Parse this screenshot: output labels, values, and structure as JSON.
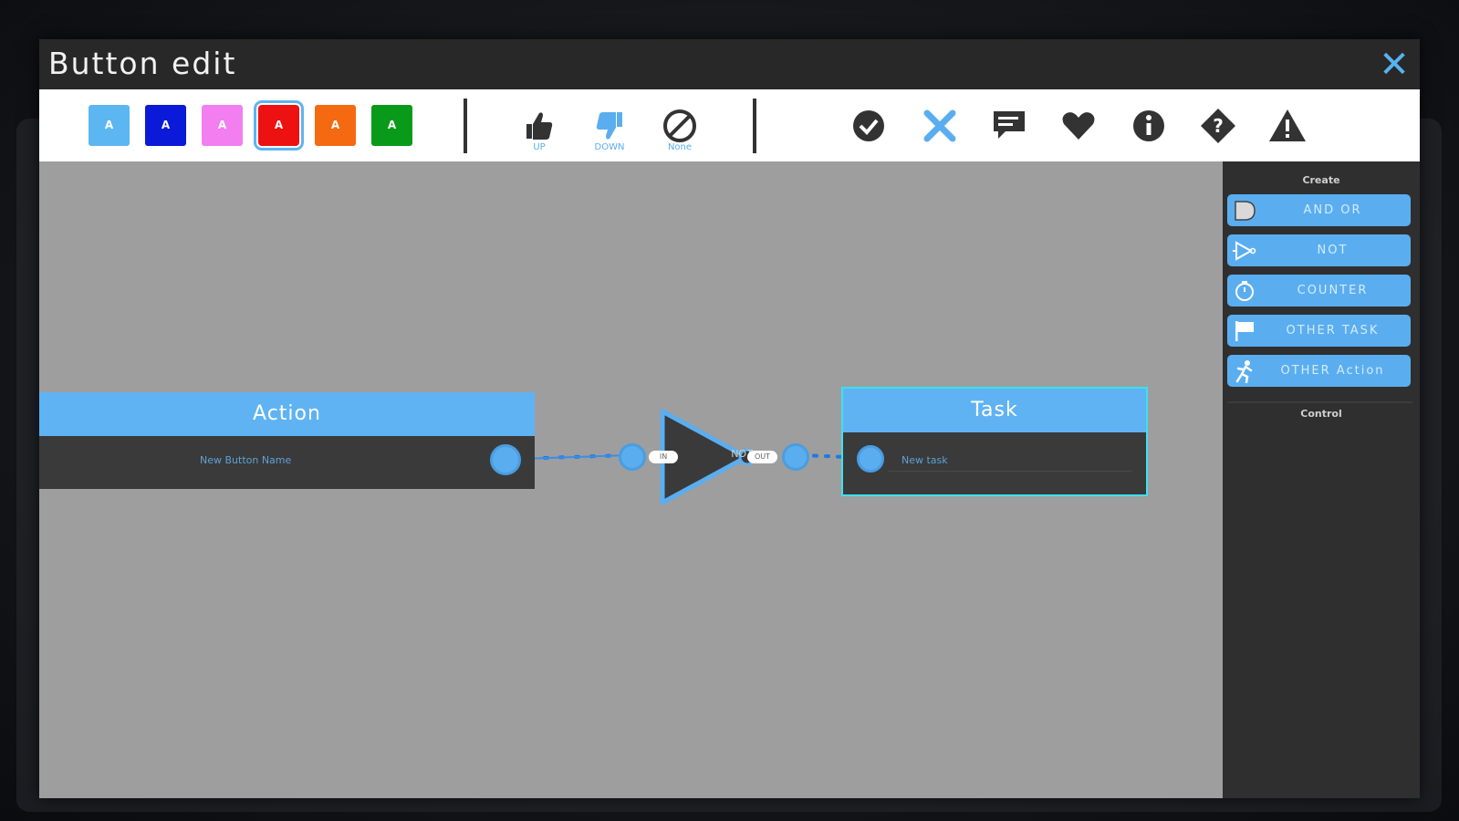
{
  "window": {
    "title": "Button edit",
    "close_label": "✕"
  },
  "toolbar": {
    "swatches": [
      {
        "label": "A",
        "color": "#5cb6f2"
      },
      {
        "label": "A",
        "color": "#0a1ad8"
      },
      {
        "label": "A",
        "color": "#f27ef0"
      },
      {
        "label": "A",
        "color": "#ee1111",
        "selected": true
      },
      {
        "label": "A",
        "color": "#f56a10"
      },
      {
        "label": "A",
        "color": "#0a9a1a"
      }
    ],
    "reactions": [
      {
        "icon": "thumbs-up-icon",
        "caption": "UP"
      },
      {
        "icon": "thumbs-down-icon",
        "caption": "DOWN"
      },
      {
        "icon": "none-icon",
        "caption": "None"
      }
    ],
    "icons": [
      "check-icon",
      "x-icon",
      "comment-icon",
      "heart-icon",
      "info-icon",
      "question-icon",
      "warning-icon"
    ]
  },
  "canvas": {
    "action_node": {
      "title": "Action",
      "field": "New Button Name"
    },
    "not_node": {
      "label": "NOT",
      "in_label": "IN",
      "out_label": "OUT"
    },
    "task_node": {
      "title": "Task",
      "field": "New task"
    }
  },
  "sidebar": {
    "create_heading": "Create",
    "buttons": [
      {
        "icon": "and-or-gate-icon",
        "label": "AND OR"
      },
      {
        "icon": "not-gate-icon",
        "label": "NOT"
      },
      {
        "icon": "timer-icon",
        "label": "COUNTER"
      },
      {
        "icon": "flag-icon",
        "label": "OTHER TASK"
      },
      {
        "icon": "running-figure-icon",
        "label": "OTHER Action"
      }
    ],
    "control_heading": "Control"
  },
  "colors": {
    "accent": "#5aaef0",
    "canvas": "#9e9e9e",
    "node_body": "#3a3a3a"
  }
}
